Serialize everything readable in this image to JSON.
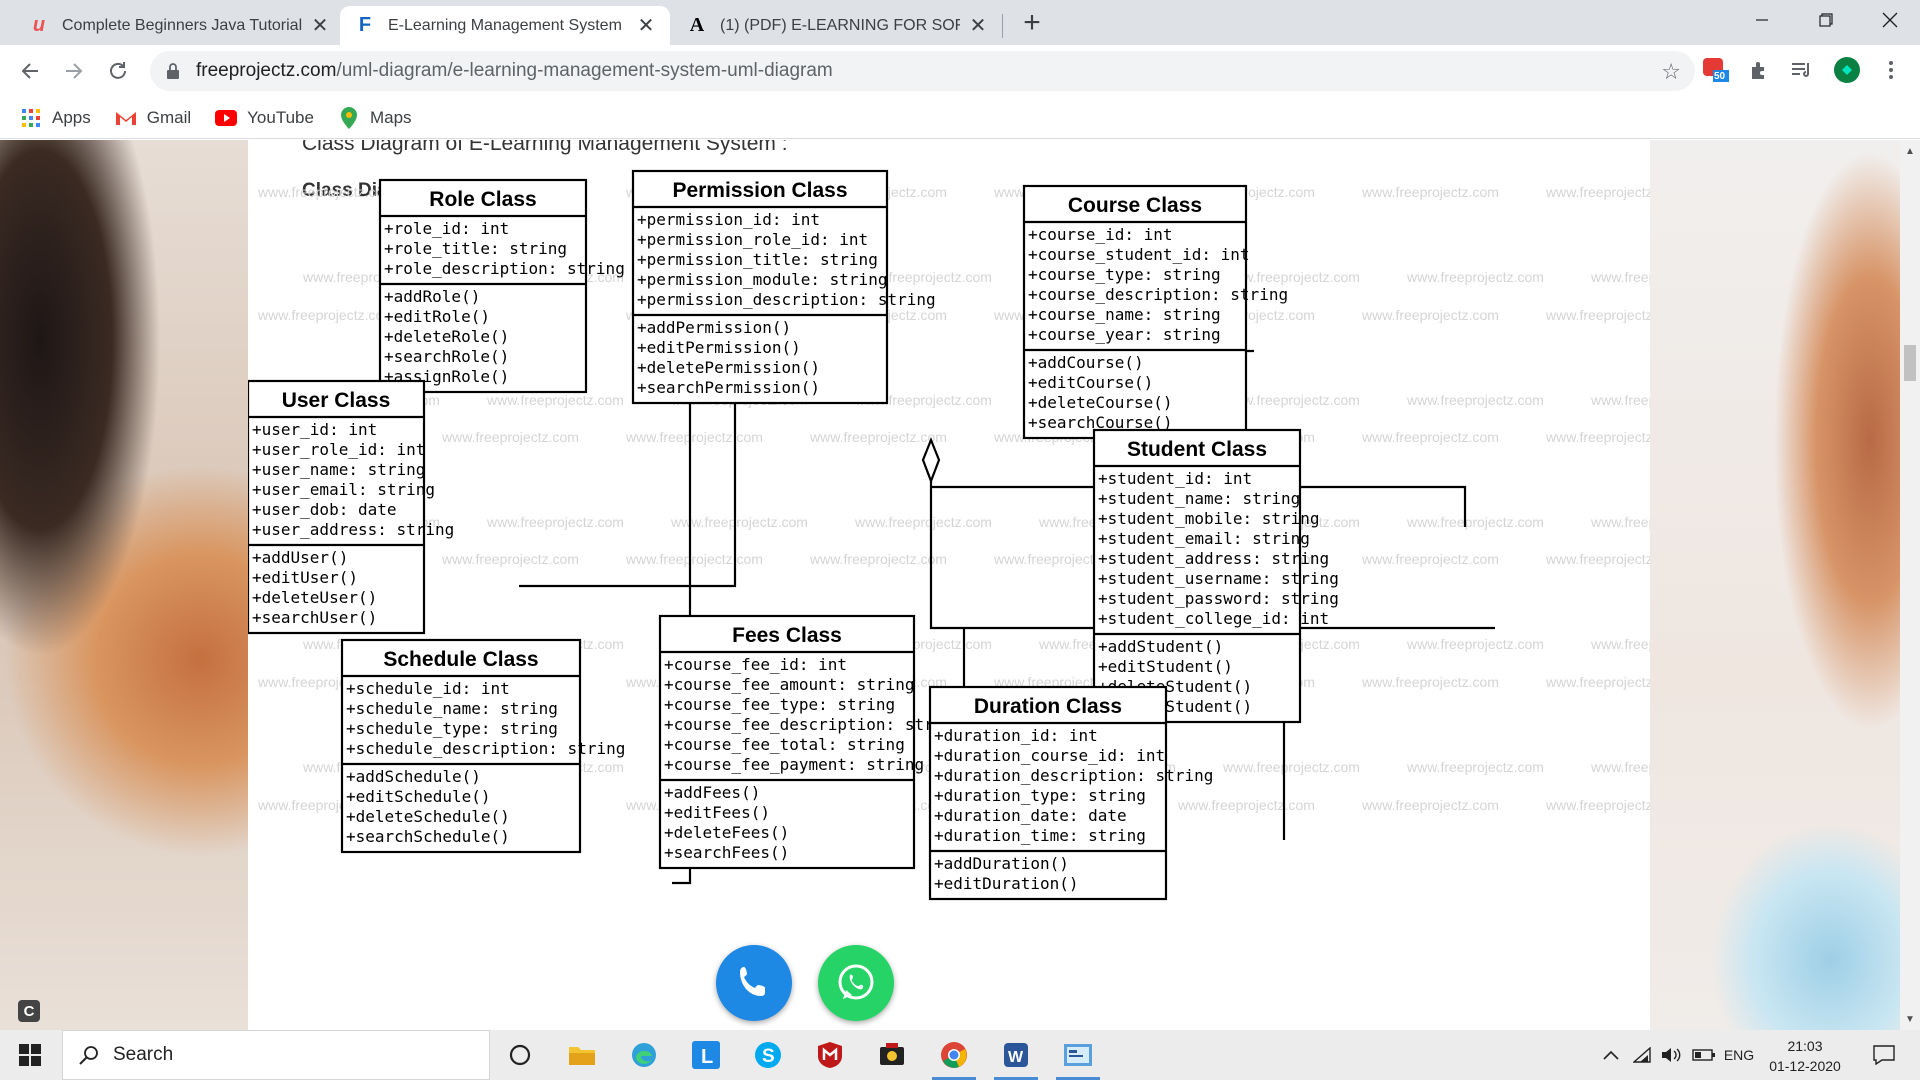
{
  "browser": {
    "tabs": [
      {
        "title": "Complete Beginners Java Tutorial",
        "favicon": "udemy-icon",
        "active": false
      },
      {
        "title": "E-Learning Management System",
        "favicon": "freeprojectz-icon",
        "active": true
      },
      {
        "title": "(1) (PDF) E-LEARNING FOR SOFT",
        "favicon": "academia-icon",
        "active": false
      }
    ],
    "new_tab_symbol": "+",
    "url_host": "freeprojectz.com",
    "url_path": "/uml-diagram/e-learning-management-system-uml-diagram",
    "extension_badge": "50",
    "bookmarks": [
      {
        "label": "Apps",
        "icon": "apps-grid-icon"
      },
      {
        "label": "Gmail",
        "icon": "gmail-icon"
      },
      {
        "label": "YouTube",
        "icon": "youtube-icon"
      },
      {
        "label": "Maps",
        "icon": "maps-pin-icon"
      }
    ]
  },
  "page": {
    "heading": "Class Diagram of E-Learning Management System :",
    "subheading": "Class Diagram Image:",
    "watermark": "www.freeprojectz.com"
  },
  "classes": {
    "role": {
      "name": "Role Class",
      "attributes": [
        "+role_id: int",
        "+role_title: string",
        "+role_description: string"
      ],
      "methods": [
        "+addRole()",
        "+editRole()",
        "+deleteRole()",
        "+searchRole()",
        "+assignRole()"
      ]
    },
    "permission": {
      "name": "Permission Class",
      "attributes": [
        "+permission_id: int",
        "+permission_role_id: int",
        "+permission_title: string",
        "+permission_module: string",
        "+permission_description: string"
      ],
      "methods": [
        "+addPermission()",
        "+editPermission()",
        "+deletePermission()",
        "+searchPermission()"
      ]
    },
    "course": {
      "name": "Course Class",
      "attributes": [
        "+course_id: int",
        "+course_student_id: int",
        "+course_type: string",
        "+course_description: string",
        "+course_name: string",
        "+course_year: string"
      ],
      "methods": [
        "+addCourse()",
        "+editCourse()",
        "+deleteCourse()",
        "+searchCourse()"
      ]
    },
    "user": {
      "name": "User Class",
      "attributes": [
        "+user_id: int",
        "+user_role_id: int",
        "+user_name: string",
        "+user_email: string",
        "+user_dob: date",
        "+user_address: string"
      ],
      "methods": [
        "+addUser()",
        "+editUser()",
        "+deleteUser()",
        "+searchUser()"
      ]
    },
    "student": {
      "name": "Student Class",
      "attributes": [
        "+student_id: int",
        "+student_name: string",
        "+student_mobile: string",
        "+student_email: string",
        "+student_address: string",
        "+student_username: string",
        "+student_password: string",
        "+student_college_id: int"
      ],
      "methods": [
        "+addStudent()",
        "+editStudent()",
        "+deleteStudent()",
        "+searchStudent()"
      ]
    },
    "fees": {
      "name": "Fees Class",
      "attributes": [
        "+course_fee_id: int",
        "+course_fee_amount: string",
        "+course_fee_type: string",
        "+course_fee_description: string",
        "+course_fee_total: string",
        "+course_fee_payment: string"
      ],
      "methods": [
        "+addFees()",
        "+editFees()",
        "+deleteFees()",
        "+searchFees()"
      ]
    },
    "schedule": {
      "name": "Schedule Class",
      "attributes": [
        "+schedule_id: int",
        "+schedule_name: string",
        "+schedule_type: string",
        "+schedule_description: string"
      ],
      "methods": [
        "+addSchedule()",
        "+editSchedule()",
        "+deleteSchedule()",
        "+searchSchedule()"
      ]
    },
    "duration": {
      "name": "Duration Class",
      "attributes": [
        "+duration_id: int",
        "+duration_course_id: int",
        "+duration_description: string",
        "+duration_type: string",
        "+duration_date: date",
        "+duration_time: string"
      ],
      "methods": [
        "+addDuration()",
        "+editDuration()"
      ]
    }
  },
  "taskbar": {
    "search_placeholder": "Search",
    "language": "ENG",
    "time": "21:03",
    "date": "01-12-2020"
  },
  "colors": {
    "tabstrip": "#dee1e6",
    "phone_button": "#1e88e5",
    "whatsapp_button": "#25d366",
    "diagram_line": "#000000"
  }
}
